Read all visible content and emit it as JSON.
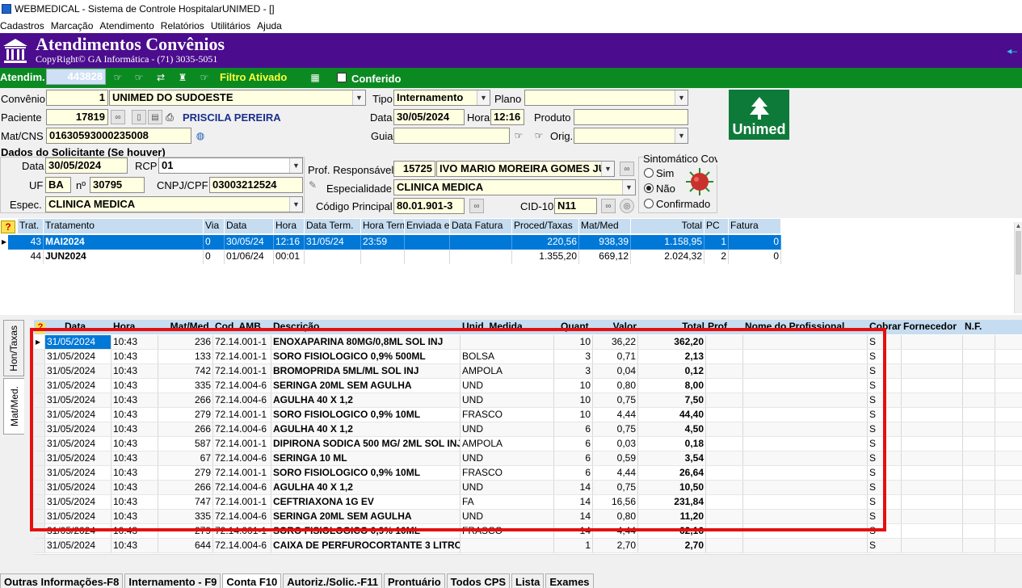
{
  "window": {
    "title": "WEBMEDICAL - Sistema de Controle HospitalarUNIMED - []"
  },
  "menu": [
    "Cadastros",
    "Marcação",
    "Atendimento",
    "Relatórios",
    "Utilitários",
    "Ajuda"
  ],
  "header": {
    "title": "Atendimentos Convênios",
    "subtitle": "CopyRight© GA Informática - (71) 3035-5051"
  },
  "toolbar": {
    "atendim_label": "Atendim.",
    "atendim_value": "443828",
    "filtro_label": "Filtro Ativado",
    "conferido_label": "Conferido"
  },
  "form": {
    "convenio_label": "Convênio",
    "convenio_code": "1",
    "convenio_name": "UNIMED DO SUDOESTE",
    "tipo_label": "Tipo",
    "tipo_value": "Internamento",
    "plano_label": "Plano",
    "plano_value": "",
    "paciente_label": "Paciente",
    "paciente_code": "17819",
    "paciente_name": "PRISCILA PEREIRA",
    "data_label": "Data",
    "data_value": "30/05/2024",
    "hora_label": "Hora",
    "hora_value": "12:16",
    "produto_label": "Produto",
    "produto_value": "",
    "matcns_label": "Mat/CNS",
    "matcns_value": "01630593000235008",
    "guia_label": "Guia",
    "guia_value": "",
    "orig_label": "Orig.",
    "orig_value": "",
    "solicitante_title": "Dados do Solicitante (Se houver)",
    "sol_data_label": "Data",
    "sol_data_value": "30/05/2024",
    "rcp_label": "RCP",
    "rcp_value": "01",
    "uf_label": "UF",
    "uf_value": "BA",
    "n_label": "nº",
    "n_value": "30795",
    "cnpj_label": "CNPJ/CPF",
    "cnpj_value": "03003212524",
    "espec_label": "Espec.",
    "espec_value": "CLINICA MEDICA",
    "prof_label": "Prof. Responsável",
    "prof_code": "15725",
    "prof_name": "IVO MARIO MOREIRA GOMES JU",
    "especialidade_label": "Especialidade",
    "especialidade_value": "CLINICA MEDICA",
    "codigo_label": "Código Principal",
    "codigo_value": "80.01.901-3",
    "cid_label": "CID-10",
    "cid_value": "N11"
  },
  "covid": {
    "title": "Sintomático Covid",
    "options": [
      "Sim",
      "Não",
      "Confirmado"
    ],
    "selected": "Não"
  },
  "unimed_logo": {
    "text": "Unimed",
    "color": "#0e7a3a"
  },
  "accounts_table": {
    "headers": [
      "Trat.",
      "Tratamento",
      "Via",
      "Data",
      "Hora",
      "Data Term.",
      "Hora Term.",
      "Enviada em",
      "Data Fatura",
      "Proced/Taxas",
      "Mat/Med",
      "Total",
      "PC",
      "Fatura"
    ],
    "rows": [
      [
        "43",
        "MAI2024",
        "0",
        "30/05/24",
        "12:16",
        "31/05/24",
        "23:59",
        "",
        "",
        "220,56",
        "938,39",
        "1.158,95",
        "1",
        "0"
      ],
      [
        "44",
        "JUN2024",
        "0",
        "01/06/24",
        "00:01",
        "",
        "",
        "",
        "",
        "1.355,20",
        "669,12",
        "2.024,32",
        "2",
        "0"
      ]
    ]
  },
  "side_tabs": [
    "Hon/Taxas",
    "Mat/Med."
  ],
  "items_table": {
    "headers": [
      "Data",
      "Hora",
      "Mat/Med.",
      "Cod. AMB",
      "Descrição",
      "Unid. Medida",
      "Quant.",
      "Valor",
      "Total",
      "Prof.",
      "Nome do Profissional",
      "Cobrar",
      "Fornecedor",
      "N.F."
    ],
    "rows": [
      [
        "31/05/2024",
        "10:43",
        "236",
        "72.14.001-1",
        "ENOXAPARINA 80MG/0,8ML SOL INJ",
        "",
        "10",
        "36,22",
        "362,20",
        "",
        "",
        "S",
        "",
        ""
      ],
      [
        "31/05/2024",
        "10:43",
        "133",
        "72.14.001-1",
        "SORO FISIOLOGICO 0,9% 500ML",
        "BOLSA",
        "3",
        "0,71",
        "2,13",
        "",
        "",
        "S",
        "",
        ""
      ],
      [
        "31/05/2024",
        "10:43",
        "742",
        "72.14.001-1",
        "BROMOPRIDA 5ML/ML SOL INJ",
        "AMPOLA",
        "3",
        "0,04",
        "0,12",
        "",
        "",
        "S",
        "",
        ""
      ],
      [
        "31/05/2024",
        "10:43",
        "335",
        "72.14.004-6",
        "SERINGA 20ML SEM AGULHA",
        "UND",
        "10",
        "0,80",
        "8,00",
        "",
        "",
        "S",
        "",
        ""
      ],
      [
        "31/05/2024",
        "10:43",
        "266",
        "72.14.004-6",
        "AGULHA 40 X 1,2",
        "UND",
        "10",
        "0,75",
        "7,50",
        "",
        "",
        "S",
        "",
        ""
      ],
      [
        "31/05/2024",
        "10:43",
        "279",
        "72.14.001-1",
        "SORO FISIOLOGICO 0,9% 10ML",
        "FRASCO",
        "10",
        "4,44",
        "44,40",
        "",
        "",
        "S",
        "",
        ""
      ],
      [
        "31/05/2024",
        "10:43",
        "266",
        "72.14.004-6",
        "AGULHA 40 X 1,2",
        "UND",
        "6",
        "0,75",
        "4,50",
        "",
        "",
        "S",
        "",
        ""
      ],
      [
        "31/05/2024",
        "10:43",
        "587",
        "72.14.001-1",
        "DIPIRONA SODICA 500 MG/ 2ML SOL INJ",
        "AMPOLA",
        "6",
        "0,03",
        "0,18",
        "",
        "",
        "S",
        "",
        ""
      ],
      [
        "31/05/2024",
        "10:43",
        "67",
        "72.14.004-6",
        "SERINGA 10 ML",
        "UND",
        "6",
        "0,59",
        "3,54",
        "",
        "",
        "S",
        "",
        ""
      ],
      [
        "31/05/2024",
        "10:43",
        "279",
        "72.14.001-1",
        "SORO FISIOLOGICO 0,9% 10ML",
        "FRASCO",
        "6",
        "4,44",
        "26,64",
        "",
        "",
        "S",
        "",
        ""
      ],
      [
        "31/05/2024",
        "10:43",
        "266",
        "72.14.004-6",
        "AGULHA 40 X 1,2",
        "UND",
        "14",
        "0,75",
        "10,50",
        "",
        "",
        "S",
        "",
        ""
      ],
      [
        "31/05/2024",
        "10:43",
        "747",
        "72.14.001-1",
        "CEFTRIAXONA 1G EV",
        "FA",
        "14",
        "16,56",
        "231,84",
        "",
        "",
        "S",
        "",
        ""
      ],
      [
        "31/05/2024",
        "10:43",
        "335",
        "72.14.004-6",
        "SERINGA 20ML SEM AGULHA",
        "UND",
        "14",
        "0,80",
        "11,20",
        "",
        "",
        "S",
        "",
        ""
      ],
      [
        "31/05/2024",
        "10:43",
        "279",
        "72.14.001-1",
        "SORO FISIOLOGICO 0,9% 10ML",
        "FRASCO",
        "14",
        "4,44",
        "62,16",
        "",
        "",
        "S",
        "",
        ""
      ],
      [
        "31/05/2024",
        "10:43",
        "644",
        "72.14.004-6",
        "CAIXA DE PERFUROCORTANTE 3 LITROS",
        "",
        "1",
        "2,70",
        "2,70",
        "",
        "",
        "S",
        "",
        ""
      ]
    ]
  },
  "bottom_tabs": [
    "Outras Informações-F8",
    "Internamento - F9",
    "Conta F10",
    "Autoriz./Solic.-F11",
    "Prontuário",
    "Todos CPS",
    "Lista",
    "Exames"
  ],
  "active_bottom_tab": "Conta F10",
  "colors": {
    "header_bg": "#4b0c8e",
    "toolbar_bg": "#0b8a22",
    "field_bg": "#ffffe1",
    "selection": "#0078d7",
    "highlight_box": "#e50f0f"
  }
}
